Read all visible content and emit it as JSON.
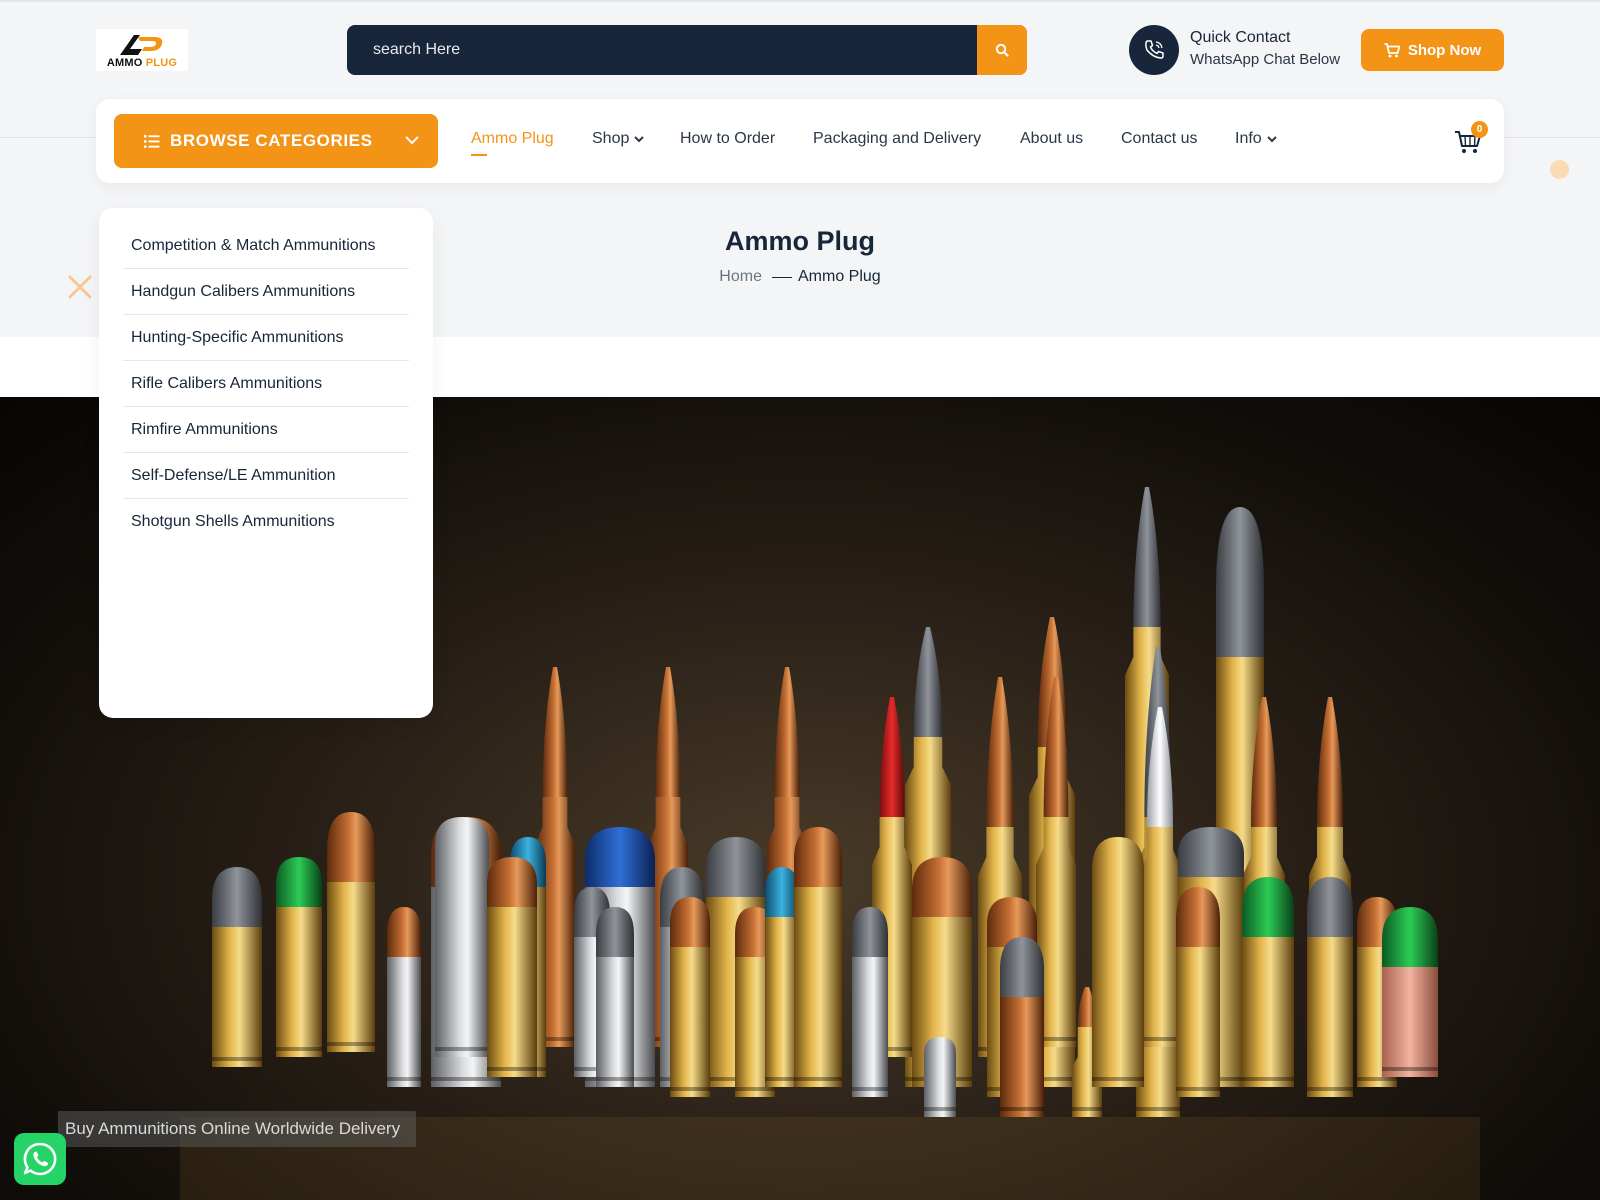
{
  "brand": {
    "logo_word1": "AMMO",
    "logo_word2": "PLUG",
    "accent": "#f39417",
    "dark": "#17263a"
  },
  "search": {
    "placeholder": "search Here",
    "icon": "search-icon"
  },
  "quick_contact": {
    "title": "Quick Contact",
    "subtitle": "WhatsApp Chat Below",
    "icon": "phone-icon"
  },
  "shop_now": {
    "label": "Shop Now",
    "icon": "cart-icon"
  },
  "nav": {
    "browse_label": "BROWSE CATEGORIES",
    "items": [
      {
        "label": "Ammo Plug",
        "active": true
      },
      {
        "label": "Shop",
        "dropdown": true
      },
      {
        "label": "How to Order"
      },
      {
        "label": "Packaging and Delivery"
      },
      {
        "label": "About us"
      },
      {
        "label": "Contact us"
      },
      {
        "label": "Info",
        "dropdown": true
      }
    ],
    "cart_count": "0"
  },
  "page_header": {
    "title": "Ammo Plug",
    "breadcrumb_home": "Home",
    "breadcrumb_current": "Ammo Plug"
  },
  "categories": [
    "Competition & Match Ammunitions",
    "Handgun Calibers Ammunitions",
    "Hunting-Specific Ammunitions",
    "Rifle Calibers Ammunitions",
    "Rimfire Ammunitions",
    "Self-Defense/LE Ammunition",
    "Shotgun Shells Ammunitions"
  ],
  "hero": {
    "caption": "Buy Ammunitions Online Worldwide Delivery"
  },
  "whatsapp": {
    "icon": "whatsapp-icon"
  }
}
